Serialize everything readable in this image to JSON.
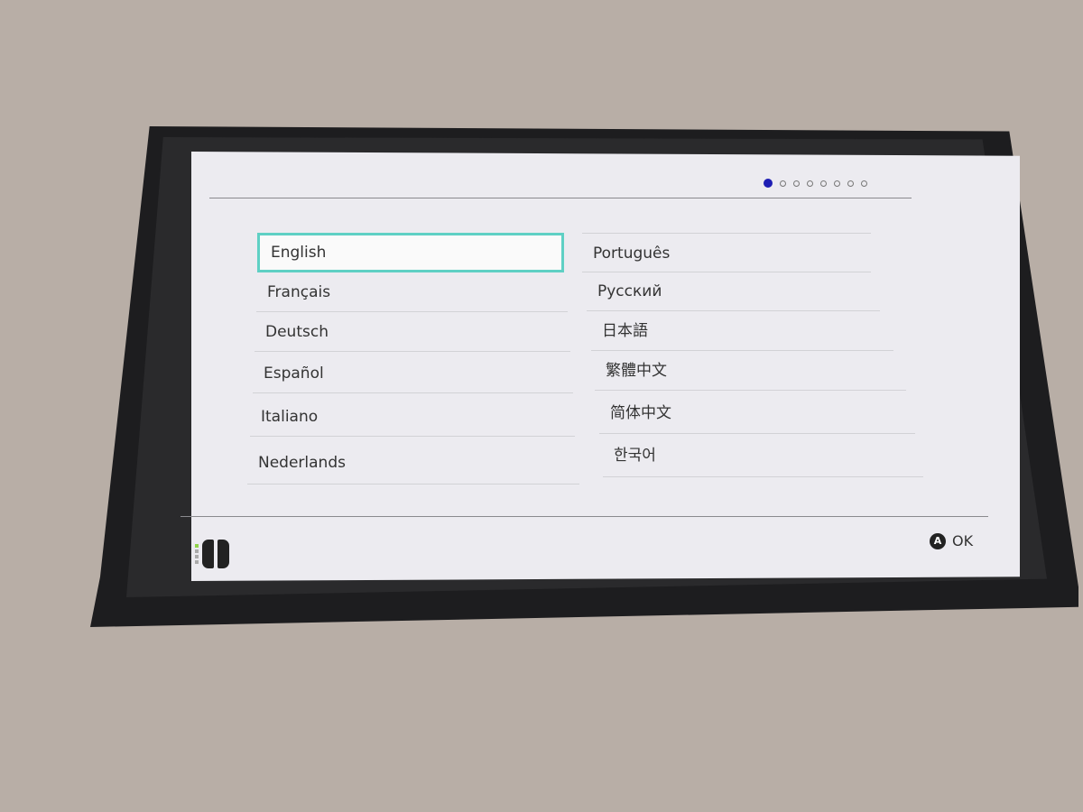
{
  "progress": {
    "total_steps": 8,
    "current_step": 1,
    "active_color": "#1e1eb4"
  },
  "languages_left": [
    "English",
    "Français",
    "Deutsch",
    "Español",
    "Italiano",
    "Nederlands"
  ],
  "languages_right": [
    "Português",
    "Русский",
    "日本語",
    "繁體中文",
    "简体中文",
    "한국어"
  ],
  "selected": "English",
  "selection_color": "#5fd0c4",
  "footer": {
    "a_button_glyph": "A",
    "ok_label": "OK",
    "controller_icon": "joy-con-pair-icon",
    "player_led": 1
  }
}
